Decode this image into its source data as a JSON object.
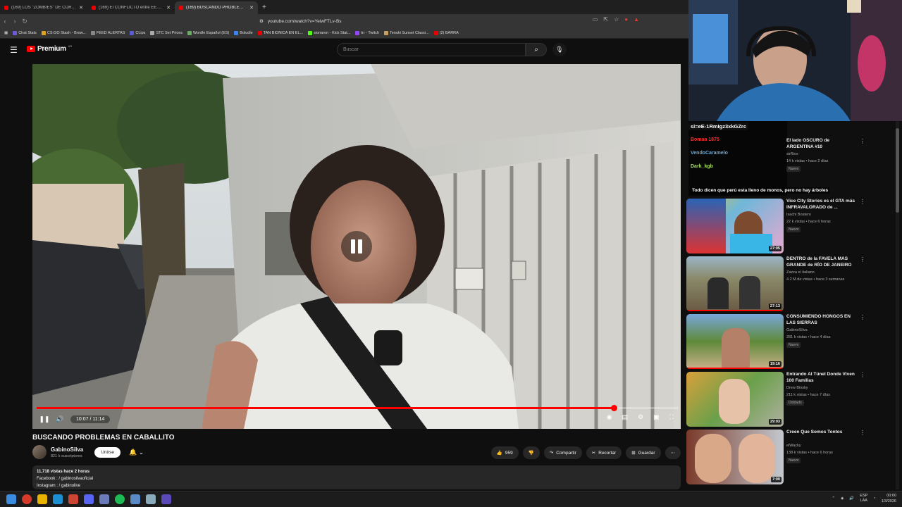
{
  "browser": {
    "tabs": [
      {
        "label": "(169) LOS \"ZOMBIES\" DE CORDOBA"
      },
      {
        "label": "(169) El CONFLICTO entre EE.UU."
      },
      {
        "label": "(169) BUSCANDO PROBLEMAS"
      }
    ],
    "url": "youtube.com/watch?v=YeiwFTLv-Bs",
    "bookmarks": [
      "Chat Stats",
      "CS:GO Stash - Brow...",
      "FEED ALERTAS",
      "CLips",
      "STC Set Prices",
      "Wordle Español (ES)",
      "Boludle",
      "TAN BIONICA EN EL...",
      "sionaron - Kick Stat...",
      "trr - Twitch",
      "Tenuki Sunset Classi...",
      "(2) BARRA"
    ]
  },
  "youtube": {
    "logo_text": "Premium",
    "logo_country": "AR",
    "search_placeholder": "Buscar"
  },
  "player": {
    "time_current": "10:07",
    "time_total": "11:14",
    "time_display": "10:07 / 11:14",
    "progress_fraction": 0.9
  },
  "video": {
    "title": "BUSCANDO PROBLEMAS EN CABALLITO",
    "channel": "GabinoSilva",
    "subscribers": "821 k suscriptores",
    "join_label": "Unirse",
    "likes": "959",
    "share_label": "Compartir",
    "clip_label": "Recortar",
    "save_label": "Guardar",
    "desc_line1": "11,718 vistas  hace 2 horas",
    "desc_line2": "Facebook :  / gabinosilvaoficial",
    "desc_line3": "Instagram :  / gabinolive"
  },
  "overlay": {
    "url_tag": "si=eE-1RmIgz3xkGZrc",
    "chat": [
      "Bomaa 1875",
      "VendoCaramelo",
      "Dark_kgb"
    ],
    "caption": "Todo dicen que perú esta lleno de monos, pero no hay árboles"
  },
  "recommendations": [
    {
      "title": "El lado OSCURO de ARGENTINA #10",
      "channel": "sirRios",
      "meta": "14 k vistas • hace 2 días",
      "badge": "Nuevo",
      "duration": ""
    },
    {
      "title": "Vice City Stories es el GTA más INFRAVALORADO de ...",
      "channel": "Isachi Bostero",
      "meta": "22 k vistas • hace 6 horas",
      "badge": "Nuevo",
      "duration": "27:05"
    },
    {
      "title": "DENTRO de la FAVELA MÁS GRANDE de RÍO DE JANEIRO ...",
      "channel": "Zazza el italiano",
      "meta": "4.2 M de vistas • hace 3 semanas",
      "badge": "",
      "duration": "27:13"
    },
    {
      "title": "CONSUMIENDO HONGOS EN LAS SIERRAS",
      "channel": "GabinoSilva",
      "meta": "281 k vistas • hace 4 días",
      "badge": "Nuevo",
      "duration": "19:16"
    },
    {
      "title": "Entrando Al Túnel Donde Viven 100 Familias",
      "channel": "Drew Binsky",
      "meta": "211 k vistas • hace 7 días",
      "badge": "Doblado",
      "duration": "29:03"
    },
    {
      "title": "Creen Que Somos Tontos",
      "channel": "elWacky",
      "meta": "138 k vistas • hace 6 horas",
      "badge": "Nuevo",
      "duration": "7:00"
    }
  ],
  "taskbar": {
    "lang": "ESP",
    "lang2": "LAA",
    "time": "00:00",
    "date": "1/3/2026"
  }
}
